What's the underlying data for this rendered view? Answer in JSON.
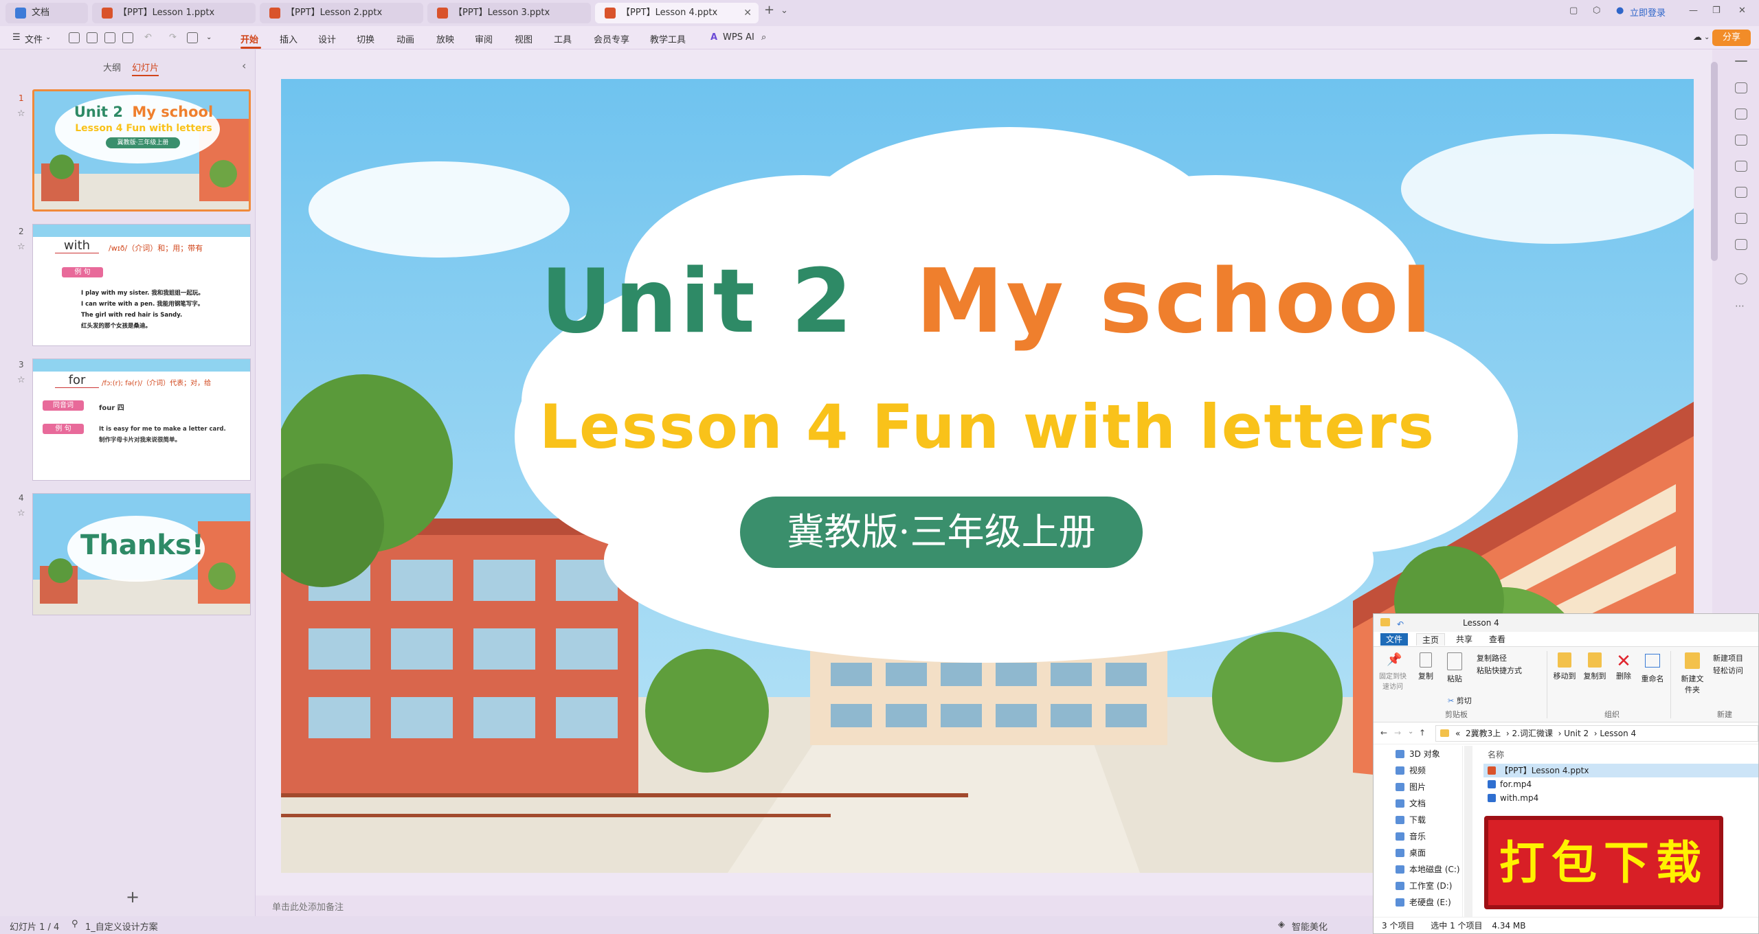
{
  "tabs": [
    {
      "label": "文档"
    },
    {
      "label": "【PPT】Lesson 1.pptx"
    },
    {
      "label": "【PPT】Lesson 2.pptx"
    },
    {
      "label": "【PPT】Lesson 3.pptx"
    },
    {
      "label": "【PPT】Lesson 4.pptx"
    }
  ],
  "titlebar": {
    "login": "立即登录"
  },
  "menu": {
    "file": "文件",
    "items": [
      "开始",
      "插入",
      "设计",
      "切换",
      "动画",
      "放映",
      "审阅",
      "视图",
      "工具",
      "会员专享",
      "教学工具"
    ],
    "wps_ai": "WPS AI",
    "share": "分享"
  },
  "pane": {
    "outline": "大纲",
    "slides": "幻灯片"
  },
  "thumbs": [
    {
      "num": "1",
      "title": "Unit 2",
      "title2": "My school",
      "subtitle": "Lesson 4 Fun with letters",
      "badge": "冀教版·三年级上册"
    },
    {
      "num": "2",
      "word": "with",
      "phon": "/wɪð/（介词）和；用；带有",
      "tag": "例 句",
      "lines": [
        "I play with my sister. 我和我姐姐一起玩。",
        "I can write with a pen. 我能用钢笔写字。",
        "The girl with red hair is Sandy.",
        "红头发的那个女孩是桑迪。"
      ]
    },
    {
      "num": "3",
      "word": "for",
      "phon": "/fɔː(r); fə(r)/（介词）代表；对，给",
      "tag1": "同音词",
      "homo": "four 四",
      "tag2": "例 句",
      "lines": [
        "It is easy for me to make a letter card.",
        "制作字母卡片对我来说很简单。"
      ]
    },
    {
      "num": "4",
      "thanks": "Thanks!"
    }
  ],
  "slide": {
    "unit": "Unit 2",
    "school": "My school",
    "lesson": "Lesson 4 Fun with letters",
    "badge": "冀教版·三年级上册"
  },
  "notes_placeholder": "单击此处添加备注",
  "status": {
    "slide_count": "幻灯片 1 / 4",
    "theme": "1_自定义设计方案",
    "beautify": "智能美化"
  },
  "explorer": {
    "title": "Lesson 4",
    "tabs": [
      "文件",
      "主页",
      "共享",
      "查看"
    ],
    "ribbon": {
      "pin": "固定到快速访问",
      "copy": "复制",
      "paste": "粘贴",
      "copy_path": "复制路径",
      "paste_shortcut": "粘贴快捷方式",
      "cut": "剪切",
      "clipboard": "剪贴板",
      "move_to": "移动到",
      "copy_to": "复制到",
      "delete": "删除",
      "rename": "重命名",
      "organize": "组织",
      "new_folder": "新建文件夹",
      "new_item": "新建项目",
      "easy_access": "轻松访问",
      "new": "新建"
    },
    "breadcrumb": [
      "«",
      "2冀教3上",
      "2.词汇微课",
      "Unit 2",
      "Lesson 4"
    ],
    "column_name": "名称",
    "sidebar": [
      "3D 对象",
      "视频",
      "图片",
      "文档",
      "下载",
      "音乐",
      "桌面",
      "本地磁盘 (C:)",
      "工作室 (D:)",
      "老硬盘 (E:)"
    ],
    "files": [
      "【PPT】Lesson 4.pptx",
      "for.mp4",
      "with.mp4"
    ],
    "status": {
      "count": "3 个项目",
      "selected": "选中 1 个项目",
      "size": "4.34 MB"
    }
  },
  "download_badge": "打包下载",
  "colors": {
    "accent": "#d1451a",
    "unit_green": "#2e8a66",
    "school_orange": "#ef7f2d",
    "lesson_yellow": "#f9c21a",
    "badge_green": "#3a8f6c"
  }
}
